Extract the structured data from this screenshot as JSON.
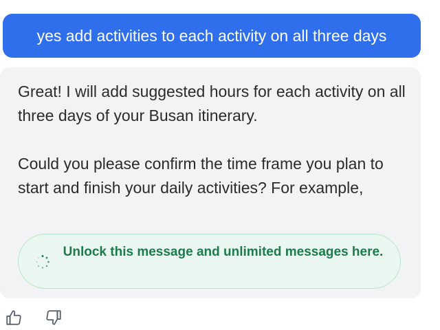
{
  "user_message": {
    "text": "yes add activities to each activity on all three days"
  },
  "assistant_message": {
    "paragraphs": [
      "Great! I will add suggested hours for each activity on all three days of your Busan itinerary.",
      "Could you please confirm the time frame you plan to start and finish your daily activities? For example,"
    ]
  },
  "unlock_banner": {
    "text": "Unlock this message and unlimited messages here.",
    "icon": "loading-spinner-icon"
  },
  "feedback": {
    "like_icon": "thumbs-up-icon",
    "dislike_icon": "thumbs-down-icon"
  },
  "colors": {
    "user_bubble": "#2f6fec",
    "assistant_bubble": "#f2f3f5",
    "unlock_text": "#1d7a4c",
    "unlock_bg": "#eaf7f0",
    "unlock_border": "#b8e6cc"
  }
}
